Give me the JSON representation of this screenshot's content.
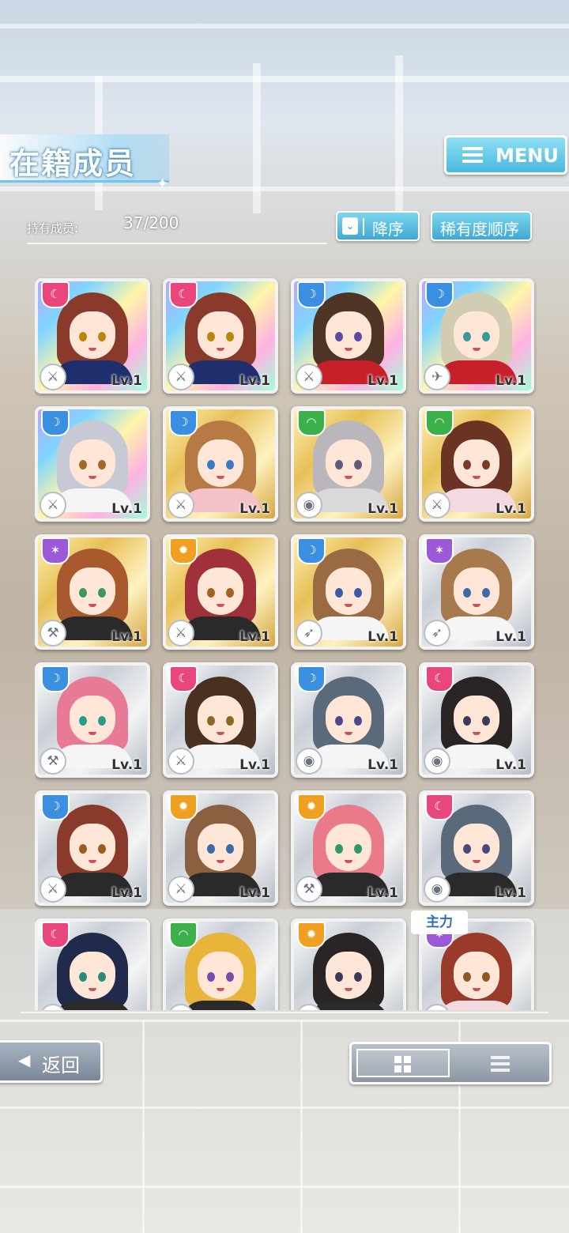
{
  "header": {
    "title": "在籍成员",
    "menu_label": "MENU"
  },
  "stats": {
    "owned_label": "持有成员:",
    "owned_value": "37/200"
  },
  "sort": {
    "order_label": "降序",
    "rarity_label": "稀有度顺序"
  },
  "cards": [
    {
      "attr": "pink",
      "rarity": "rainbow",
      "level": "Lv.1",
      "hair": "#8a3a2a",
      "eyes": "#b8860b",
      "shirt": "#1f2f6e",
      "weapon": "sword"
    },
    {
      "attr": "pink",
      "rarity": "rainbow",
      "level": "Lv.1",
      "hair": "#8a3a2a",
      "eyes": "#b8860b",
      "shirt": "#1f2f6e",
      "weapon": "sword"
    },
    {
      "attr": "blue",
      "rarity": "rainbow",
      "level": "Lv.1",
      "hair": "#4e3425",
      "eyes": "#5a4aa0",
      "shirt": "#c8202a",
      "weapon": "sword"
    },
    {
      "attr": "blue",
      "rarity": "rainbow",
      "level": "Lv.1",
      "hair": "#d2cdb2",
      "eyes": "#3a9a9a",
      "shirt": "#c8202a",
      "weapon": "gun"
    },
    {
      "attr": "blue",
      "rarity": "rainbow",
      "level": "Lv.1",
      "hair": "#c7c9d4",
      "eyes": "#a0662a",
      "shirt": "#f5f5f5",
      "weapon": "sword"
    },
    {
      "attr": "blue",
      "rarity": "gold",
      "level": "Lv.1",
      "hair": "#b87a45",
      "eyes": "#3a78c8",
      "shirt": "#f3c2c8",
      "weapon": "sword"
    },
    {
      "attr": "green",
      "rarity": "gold",
      "level": "Lv.1",
      "hair": "#b9b6bc",
      "eyes": "#5a5a7a",
      "shirt": "#d9d9d9",
      "weapon": "shield"
    },
    {
      "attr": "green",
      "rarity": "gold",
      "level": "Lv.1",
      "hair": "#6a3424",
      "eyes": "#7a3a2a",
      "shirt": "#f3d9e0",
      "weapon": "sword"
    },
    {
      "attr": "purple",
      "rarity": "gold",
      "level": "Lv.1",
      "hair": "#a85a2e",
      "eyes": "#3a9a5a",
      "shirt": "#2a2a2a",
      "weapon": "hammer"
    },
    {
      "attr": "orange",
      "rarity": "gold",
      "level": "Lv.1",
      "hair": "#a0303a",
      "eyes": "#a06020",
      "shirt": "#2a2a2a",
      "weapon": "sword"
    },
    {
      "attr": "blue",
      "rarity": "gold",
      "level": "Lv.1",
      "hair": "#9a6a42",
      "eyes": "#3a5aa8",
      "shirt": "#f5f5f5",
      "weapon": "rocket"
    },
    {
      "attr": "purple",
      "rarity": "silver",
      "level": "Lv.1",
      "hair": "#a8794c",
      "eyes": "#3a6aa8",
      "shirt": "#f5f5f5",
      "weapon": "rocket"
    },
    {
      "attr": "blue",
      "rarity": "silver",
      "level": "Lv.1",
      "hair": "#e87a98",
      "eyes": "#2a9a8a",
      "shirt": "#f5f5f5",
      "weapon": "hammer"
    },
    {
      "attr": "pink",
      "rarity": "silver",
      "level": "Lv.1",
      "hair": "#4a3020",
      "eyes": "#8a6a20",
      "shirt": "#f5f5f5",
      "weapon": "sword"
    },
    {
      "attr": "blue",
      "rarity": "silver",
      "level": "Lv.1",
      "hair": "#5a6a7a",
      "eyes": "#4a4a8a",
      "shirt": "#f5f5f5",
      "weapon": "shield"
    },
    {
      "attr": "pink",
      "rarity": "silver",
      "level": "Lv.1",
      "hair": "#2a2424",
      "eyes": "#3a3a5a",
      "shirt": "#f5f5f5",
      "weapon": "shield"
    },
    {
      "attr": "blue",
      "rarity": "silver",
      "level": "Lv.1",
      "hair": "#8a3a2a",
      "eyes": "#9a5a20",
      "shirt": "#2a2a2a",
      "weapon": "sword"
    },
    {
      "attr": "orange",
      "rarity": "silver",
      "level": "Lv.1",
      "hair": "#8a6040",
      "eyes": "#3a6aa8",
      "shirt": "#2a2a2a",
      "weapon": "sword"
    },
    {
      "attr": "orange",
      "rarity": "silver",
      "level": "Lv.1",
      "hair": "#e87a8a",
      "eyes": "#2a9a6a",
      "shirt": "#2a2a2a",
      "weapon": "hammer"
    },
    {
      "attr": "pink",
      "rarity": "silver",
      "level": "Lv.1",
      "hair": "#5a6a7a",
      "eyes": "#4a4a7a",
      "shirt": "#2a2a2a",
      "weapon": "shield"
    },
    {
      "attr": "pink",
      "rarity": "silver",
      "level": "",
      "hair": "#202a4a",
      "eyes": "#2a8a7a",
      "shirt": "#2a2a2a",
      "weapon": "sword"
    },
    {
      "attr": "green",
      "rarity": "silver",
      "level": "",
      "hair": "#e8b43a",
      "eyes": "#7a4ab0",
      "shirt": "#2a2a2a",
      "weapon": "sword"
    },
    {
      "attr": "orange",
      "rarity": "silver",
      "level": "",
      "hair": "#2a2424",
      "eyes": "#3a3a5a",
      "shirt": "#2a2a2a",
      "weapon": "sword"
    },
    {
      "attr": "purple",
      "rarity": "silver",
      "level": "",
      "hair": "#9a3a2a",
      "eyes": "#8a5a20",
      "shirt": "#f3d9e0",
      "weapon": "sword"
    }
  ],
  "main_tag": "主力",
  "footer": {
    "back_label": "返回"
  },
  "icons": {
    "attr_pink": "crescent-icon",
    "attr_blue": "moon-icon",
    "attr_green": "arc-icon",
    "attr_purple": "star-icon",
    "attr_orange": "sun-icon",
    "weapon_sword": "sword-icon",
    "weapon_gun": "gun-icon",
    "weapon_shield": "shield-icon",
    "weapon_hammer": "hammer-icon",
    "weapon_rocket": "rocket-icon"
  }
}
